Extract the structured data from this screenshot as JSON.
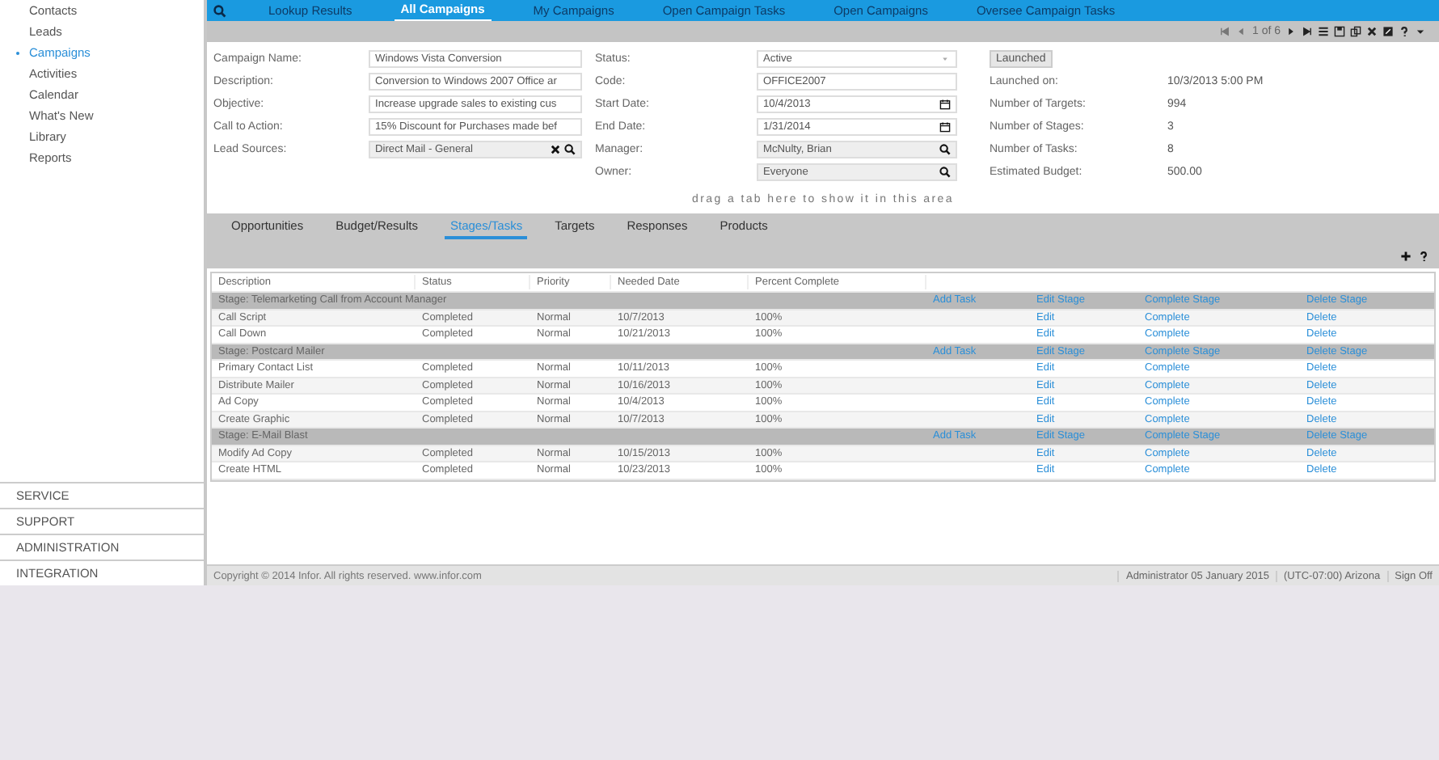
{
  "nav_tabs": [
    {
      "label": "Lookup Results",
      "selected": false
    },
    {
      "label": "All Campaigns",
      "selected": true
    },
    {
      "label": "My Campaigns",
      "selected": false
    },
    {
      "label": "Open Campaign Tasks",
      "selected": false
    },
    {
      "label": "Open Campaigns",
      "selected": false
    },
    {
      "label": "Oversee Campaign Tasks",
      "selected": false
    }
  ],
  "toolbar": {
    "pager": "1 of 6"
  },
  "sidebar": {
    "items": [
      {
        "label": "Contacts",
        "selected": false
      },
      {
        "label": "Leads",
        "selected": false
      },
      {
        "label": "Campaigns",
        "selected": true
      },
      {
        "label": "Activities",
        "selected": false
      },
      {
        "label": "Calendar",
        "selected": false
      },
      {
        "label": "What's New",
        "selected": false
      },
      {
        "label": "Library",
        "selected": false
      },
      {
        "label": "Reports",
        "selected": false
      }
    ],
    "sections": [
      "SERVICE",
      "SUPPORT",
      "ADMINISTRATION",
      "INTEGRATION"
    ]
  },
  "form": {
    "left": [
      {
        "label": "Campaign Name:",
        "value": "Windows Vista Conversion",
        "kind": "text"
      },
      {
        "label": "Description:",
        "value": "Conversion to Windows 2007 Office ar",
        "kind": "text"
      },
      {
        "label": "Objective:",
        "value": "Increase upgrade sales to existing cus",
        "kind": "text"
      },
      {
        "label": "Call to Action:",
        "value": "15% Discount for Purchases made bef",
        "kind": "text"
      },
      {
        "label": "Lead Sources:",
        "value": "Direct Mail - General",
        "kind": "lookup-clear"
      }
    ],
    "middle": [
      {
        "label": "Status:",
        "value": "Active",
        "kind": "select"
      },
      {
        "label": "Code:",
        "value": "OFFICE2007",
        "kind": "text"
      },
      {
        "label": "Start Date:",
        "value": "10/4/2013",
        "kind": "date"
      },
      {
        "label": "End Date:",
        "value": "1/31/2014",
        "kind": "date"
      },
      {
        "label": "Manager:",
        "value": "McNulty, Brian",
        "kind": "lookup"
      },
      {
        "label": "Owner:",
        "value": "Everyone",
        "kind": "lookup"
      }
    ],
    "launch_button": "Launched",
    "info": [
      {
        "label": "Launched on:",
        "value": "10/3/2013 5:00 PM"
      },
      {
        "label": "Number of Targets:",
        "value": "994"
      },
      {
        "label": "Number of Stages:",
        "value": "3"
      },
      {
        "label": "Number of Tasks:",
        "value": "8"
      },
      {
        "label": "Estimated Budget:",
        "value": "500.00"
      }
    ]
  },
  "drop_hint": "drag a tab here to show it in this area",
  "detail_tabs": [
    {
      "label": "Opportunities",
      "selected": false
    },
    {
      "label": "Budget/Results",
      "selected": false
    },
    {
      "label": "Stages/Tasks",
      "selected": true
    },
    {
      "label": "Targets",
      "selected": false
    },
    {
      "label": "Responses",
      "selected": false
    },
    {
      "label": "Products",
      "selected": false
    }
  ],
  "table": {
    "columns": [
      "Description",
      "Status",
      "Priority",
      "Needed Date",
      "Percent Complete"
    ],
    "rows": [
      {
        "kind": "stage",
        "label": "Stage: Telemarketing Call from Account Manager",
        "actions": [
          "Add Task",
          "Edit Stage",
          "Complete Stage",
          "Delete Stage"
        ]
      },
      {
        "kind": "task",
        "cells": [
          "Call Script",
          "Completed",
          "Normal",
          "10/7/2013",
          "100%"
        ],
        "actions": [
          "Edit",
          "Complete",
          "Delete"
        ]
      },
      {
        "kind": "task",
        "cells": [
          "Call Down",
          "Completed",
          "Normal",
          "10/21/2013",
          "100%"
        ],
        "actions": [
          "Edit",
          "Complete",
          "Delete"
        ]
      },
      {
        "kind": "stage",
        "label": "Stage: Postcard Mailer",
        "actions": [
          "Add Task",
          "Edit Stage",
          "Complete Stage",
          "Delete Stage"
        ]
      },
      {
        "kind": "task",
        "cells": [
          "Primary Contact List",
          "Completed",
          "Normal",
          "10/11/2013",
          "100%"
        ],
        "actions": [
          "Edit",
          "Complete",
          "Delete"
        ]
      },
      {
        "kind": "task",
        "cells": [
          "Distribute Mailer",
          "Completed",
          "Normal",
          "10/16/2013",
          "100%"
        ],
        "actions": [
          "Edit",
          "Complete",
          "Delete"
        ]
      },
      {
        "kind": "task",
        "cells": [
          "Ad Copy",
          "Completed",
          "Normal",
          "10/4/2013",
          "100%"
        ],
        "actions": [
          "Edit",
          "Complete",
          "Delete"
        ]
      },
      {
        "kind": "task",
        "cells": [
          "Create Graphic",
          "Completed",
          "Normal",
          "10/7/2013",
          "100%"
        ],
        "actions": [
          "Edit",
          "Complete",
          "Delete"
        ]
      },
      {
        "kind": "stage",
        "label": "Stage: E-Mail Blast",
        "actions": [
          "Add Task",
          "Edit Stage",
          "Complete Stage",
          "Delete Stage"
        ]
      },
      {
        "kind": "task",
        "cells": [
          "Modify Ad Copy",
          "Completed",
          "Normal",
          "10/15/2013",
          "100%"
        ],
        "actions": [
          "Edit",
          "Complete",
          "Delete"
        ]
      },
      {
        "kind": "task",
        "cells": [
          "Create HTML",
          "Completed",
          "Normal",
          "10/23/2013",
          "100%"
        ],
        "actions": [
          "Edit",
          "Complete",
          "Delete"
        ]
      }
    ]
  },
  "status_bar": {
    "copyright": "Copyright © 2014 Infor. All rights reserved. www.infor.com",
    "user_date": "Administrator 05 January 2015",
    "timezone": "(UTC-07:00) Arizona",
    "sign_off": "Sign Off"
  }
}
